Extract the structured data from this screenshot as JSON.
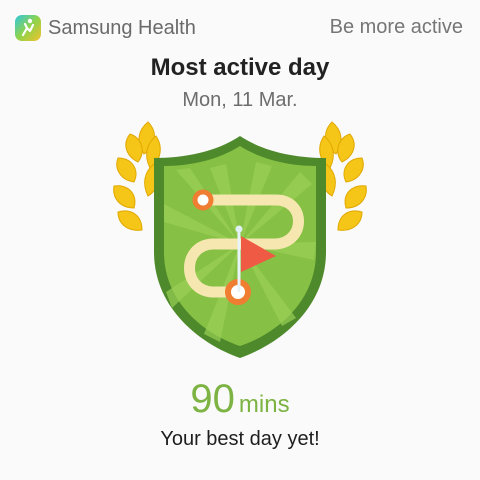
{
  "header": {
    "app_name": "Samsung Health",
    "app_icon": "samsung-health-icon",
    "action_label": "Be more active"
  },
  "achievement": {
    "title": "Most active day",
    "date": "Mon, 11 Mar.",
    "value": "90",
    "unit": "mins",
    "caption": "Your best day yet!",
    "badge_icon": "trophy-shield-flag-path-icon"
  },
  "colors": {
    "accent_green": "#7cb342",
    "shield_dark_green": "#558b2f",
    "shield_green": "#8bc34a",
    "laurel_gold": "#f5c518",
    "path_cream": "#f6e7b0",
    "marker_orange": "#ef7d32",
    "flag_red": "#ef5a45"
  }
}
